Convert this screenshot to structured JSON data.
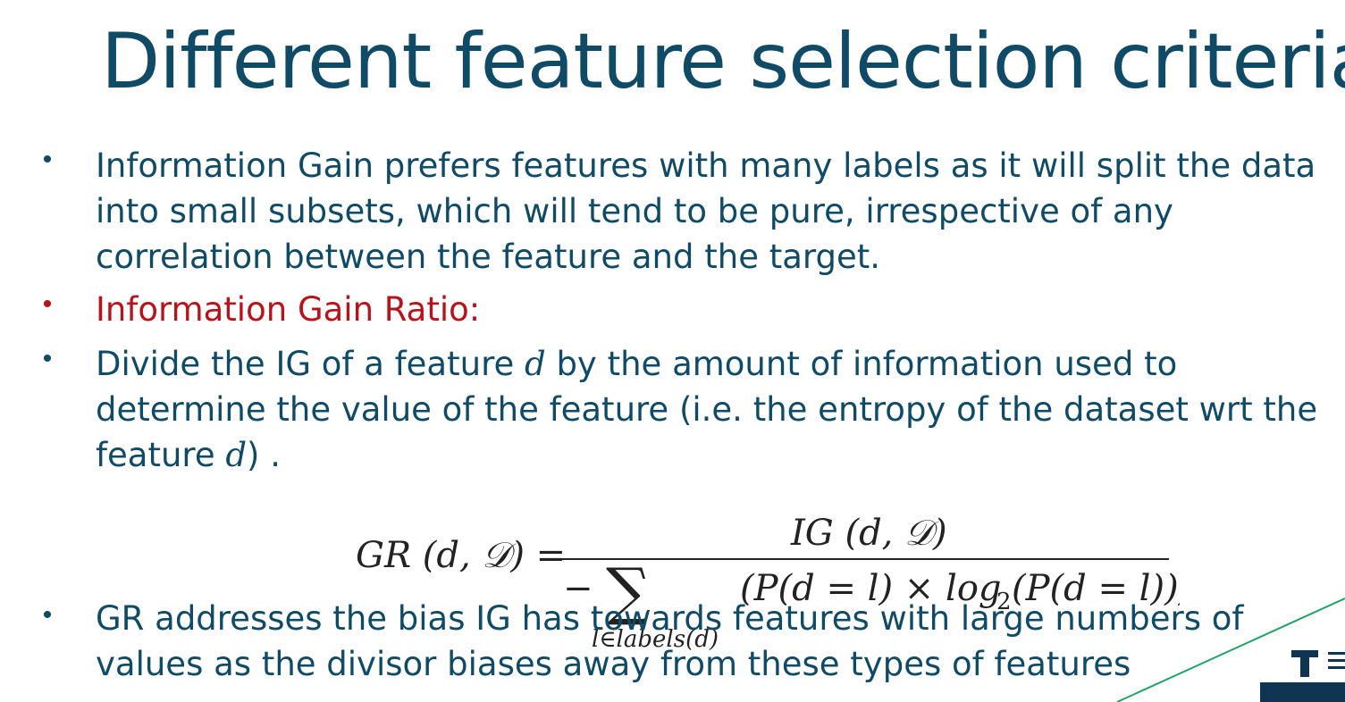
{
  "slide": {
    "title": "Different feature selection criteria"
  },
  "bullets": [
    {
      "id": "b1",
      "text": "Information Gain prefers features with many labels as it will split the data into small subsets, which will tend to be pure, irrespective of any correlation between the feature and the target."
    },
    {
      "id": "b2",
      "text": "Information Gain Ratio:"
    },
    {
      "id": "b3",
      "pre": "Divide the IG of a feature ",
      "var1": "d",
      "mid": " by the amount of information used to determine the value of the feature (i.e. the entropy of the dataset wrt the feature ",
      "var2": "d",
      "post": ") ."
    },
    {
      "id": "b4",
      "text": "GR addresses the bias IG has towards features with large numbers of values as the divisor biases away from these types of features"
    }
  ],
  "formula": {
    "lhs": "GR (d, 𝒟) =",
    "numerator": "IG (d, 𝒟)",
    "minus": "−",
    "sum": "∑",
    "sum_sub": "l∈labels(d)",
    "denominator_body": "(P(d = l) × log",
    "log_sub": "2",
    "denominator_tail": "(P(d = l)))"
  },
  "colors": {
    "title": "#0f4a66",
    "text": "#0f4a66",
    "accent_red": "#b8121a",
    "logo_line": "#1fa463"
  }
}
